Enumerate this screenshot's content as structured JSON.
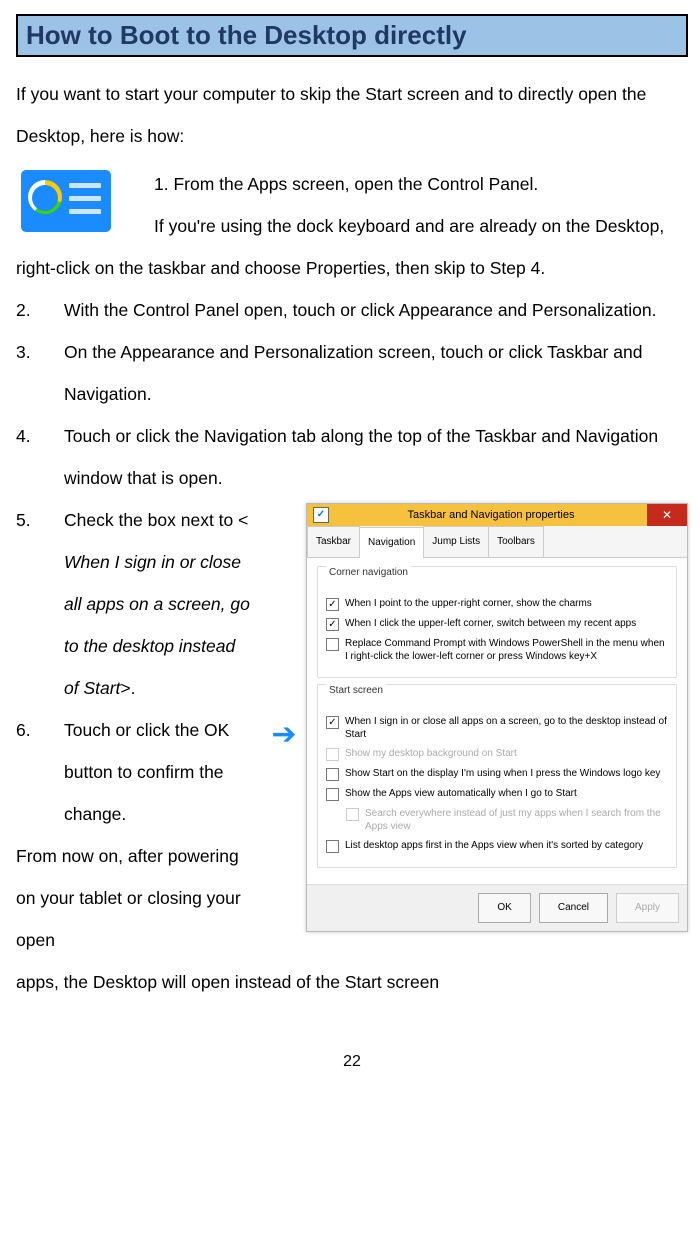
{
  "title": "How to Boot to the Desktop directly",
  "intro": "If you want to start your computer to skip the Start screen and to directly open the Desktop, here is how:",
  "step1_a": "1. From the Apps screen, open the Control Panel.",
  "step1_b": "If you're using the dock keyboard and are already on the Desktop, right-click on the taskbar and choose Properties, then skip to Step 4.",
  "step2_num": "2.",
  "step2": "With the Control Panel open, touch or click Appearance and Personalization.",
  "step3_num": "3.",
  "step3": "On the Appearance and Personalization screen, touch or click Taskbar and Navigation.",
  "step4_num": "4.",
  "step4": "Touch or click the Navigation tab along the top of the Taskbar and Navigation window that is open.",
  "step5_num": "5.",
  "step5_a": "Check the box next to < ",
  "step5_b": "When I sign in or close all apps on a screen, go to the desktop instead of Start",
  "step5_c": ">.",
  "step6_num": "6.",
  "step6": "Touch or click the OK button to confirm the change.",
  "concl_a": "From now on, after powering on your tablet or closing your open",
  "concl_b": "apps, the Desktop will open instead of the Start screen",
  "page_number": "22",
  "dialog": {
    "title": "Taskbar and Navigation properties",
    "tabs": [
      "Taskbar",
      "Navigation",
      "Jump Lists",
      "Toolbars"
    ],
    "group1": "Corner navigation",
    "g1_c1": "When I point to the upper-right corner, show the charms",
    "g1_c2": "When I click the upper-left corner, switch between my recent apps",
    "g1_c3": "Replace Command Prompt with Windows PowerShell in the menu when I right-click the lower-left corner or press Windows key+X",
    "group2": "Start screen",
    "g2_c1": "When I sign in or close all apps on a screen, go to the desktop instead of Start",
    "g2_c2": "Show my desktop background on Start",
    "g2_c3": "Show Start on the display I'm using when I press the Windows logo key",
    "g2_c4": "Show the Apps view automatically when I go to Start",
    "g2_c5": "Search everywhere instead of just my apps when I search from the Apps view",
    "g2_c6": "List desktop apps first in the Apps view when it's sorted by category",
    "btn_ok": "OK",
    "btn_cancel": "Cancel",
    "btn_apply": "Apply"
  }
}
